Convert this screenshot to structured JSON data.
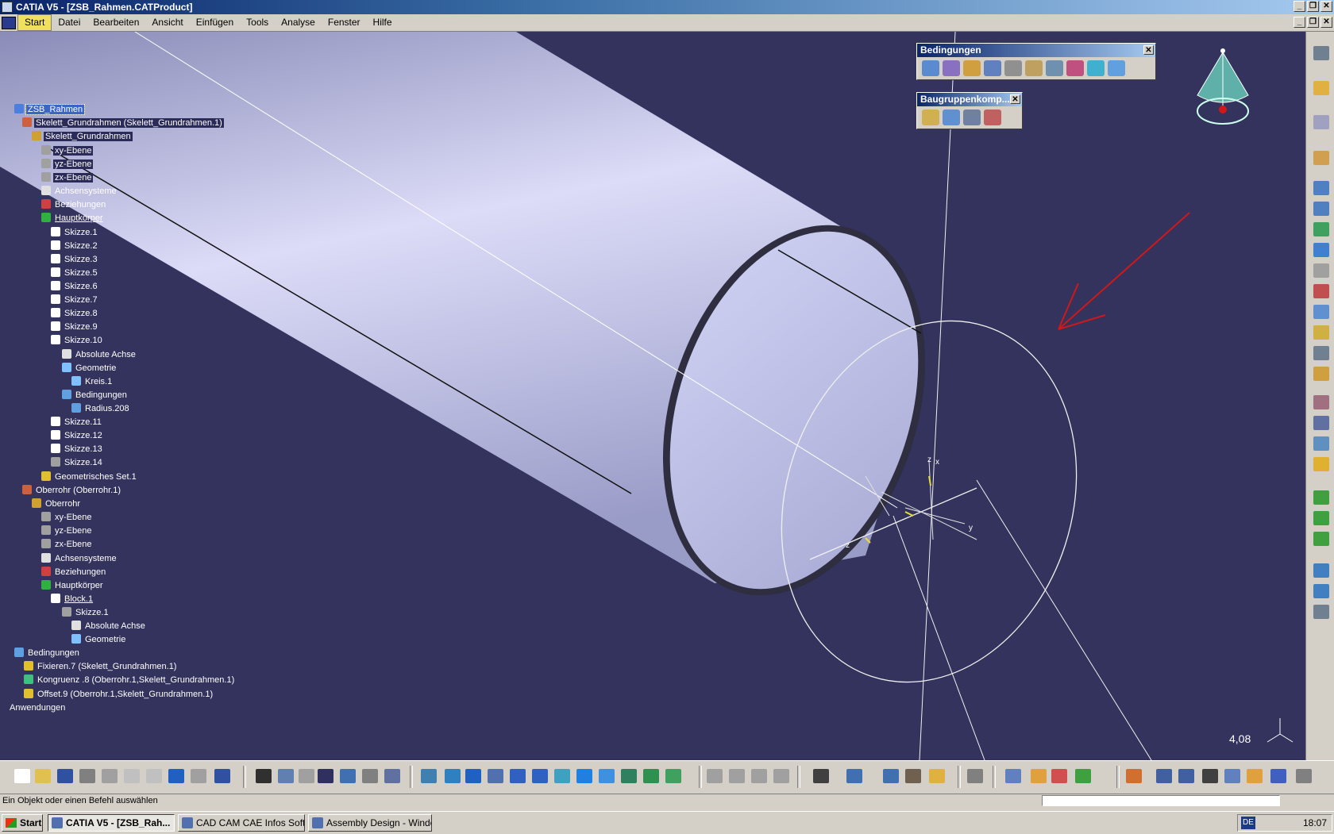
{
  "window": {
    "title": "CATIA V5 - [ZSB_Rahmen.CATProduct]"
  },
  "menu": [
    "Start",
    "Datei",
    "Bearbeiten",
    "Ansicht",
    "Einfügen",
    "Tools",
    "Analyse",
    "Fenster",
    "Hilfe"
  ],
  "tree": [
    {
      "label": "ZSB_Rahmen"
    },
    {
      "label": "Skelett_Grundrahmen (Skelett_Grundrahmen.1)"
    },
    {
      "label": "Skelett_Grundrahmen"
    },
    {
      "label": "xy-Ebene"
    },
    {
      "label": "yz-Ebene"
    },
    {
      "label": "zx-Ebene"
    },
    {
      "label": "Achsensysteme"
    },
    {
      "label": "Beziehungen"
    },
    {
      "label": "Hauptkörper"
    },
    {
      "label": "Skizze.1"
    },
    {
      "label": "Skizze.2"
    },
    {
      "label": "Skizze.3"
    },
    {
      "label": "Skizze.5"
    },
    {
      "label": "Skizze.6"
    },
    {
      "label": "Skizze.7"
    },
    {
      "label": "Skizze.8"
    },
    {
      "label": "Skizze.9"
    },
    {
      "label": "Skizze.10"
    },
    {
      "label": "Absolute Achse"
    },
    {
      "label": "Geometrie"
    },
    {
      "label": "Kreis.1"
    },
    {
      "label": "Bedingungen"
    },
    {
      "label": "Radius.208"
    },
    {
      "label": "Skizze.11"
    },
    {
      "label": "Skizze.12"
    },
    {
      "label": "Skizze.13"
    },
    {
      "label": "Skizze.14"
    },
    {
      "label": "Geometrisches Set.1"
    },
    {
      "label": "Oberrohr (Oberrohr.1)"
    },
    {
      "label": "Oberrohr"
    },
    {
      "label": "xy-Ebene"
    },
    {
      "label": "yz-Ebene"
    },
    {
      "label": "zx-Ebene"
    },
    {
      "label": "Achsensysteme"
    },
    {
      "label": "Beziehungen"
    },
    {
      "label": "Hauptkörper"
    },
    {
      "label": "Block.1"
    },
    {
      "label": "Skizze.1"
    },
    {
      "label": "Absolute Achse"
    },
    {
      "label": "Geometrie"
    },
    {
      "label": "Bedingungen"
    },
    {
      "label": "Fixieren.7 (Skelett_Grundrahmen.1)"
    },
    {
      "label": "Kongruenz .8 (Oberrohr.1,Skelett_Grundrahmen.1)"
    },
    {
      "label": "Offset.9 (Oberrohr.1,Skelett_Grundrahmen.1)"
    },
    {
      "label": "Anwendungen"
    }
  ],
  "panels": {
    "bedingungen": {
      "title": "Bedingungen"
    },
    "baugruppen": {
      "title": "Baugruppenkomp..."
    }
  },
  "viewport": {
    "zoom": "4,08",
    "axis_z": "z",
    "axis_x": "x",
    "axis_y": "y"
  },
  "status": {
    "message": "Ein Objekt oder einen Befehl auswählen"
  },
  "taskbar": {
    "start": "Start",
    "items": [
      "CATIA V5 - [ZSB_Rah...",
      "CAD CAM CAE Infos Soft...",
      "Assembly Design - Windo..."
    ],
    "lang": "DE",
    "clock": "18:07"
  },
  "colors": {
    "viewport_bg": "#33335d",
    "title_bar": "#0a246a",
    "tube": "#c4c6ea"
  }
}
